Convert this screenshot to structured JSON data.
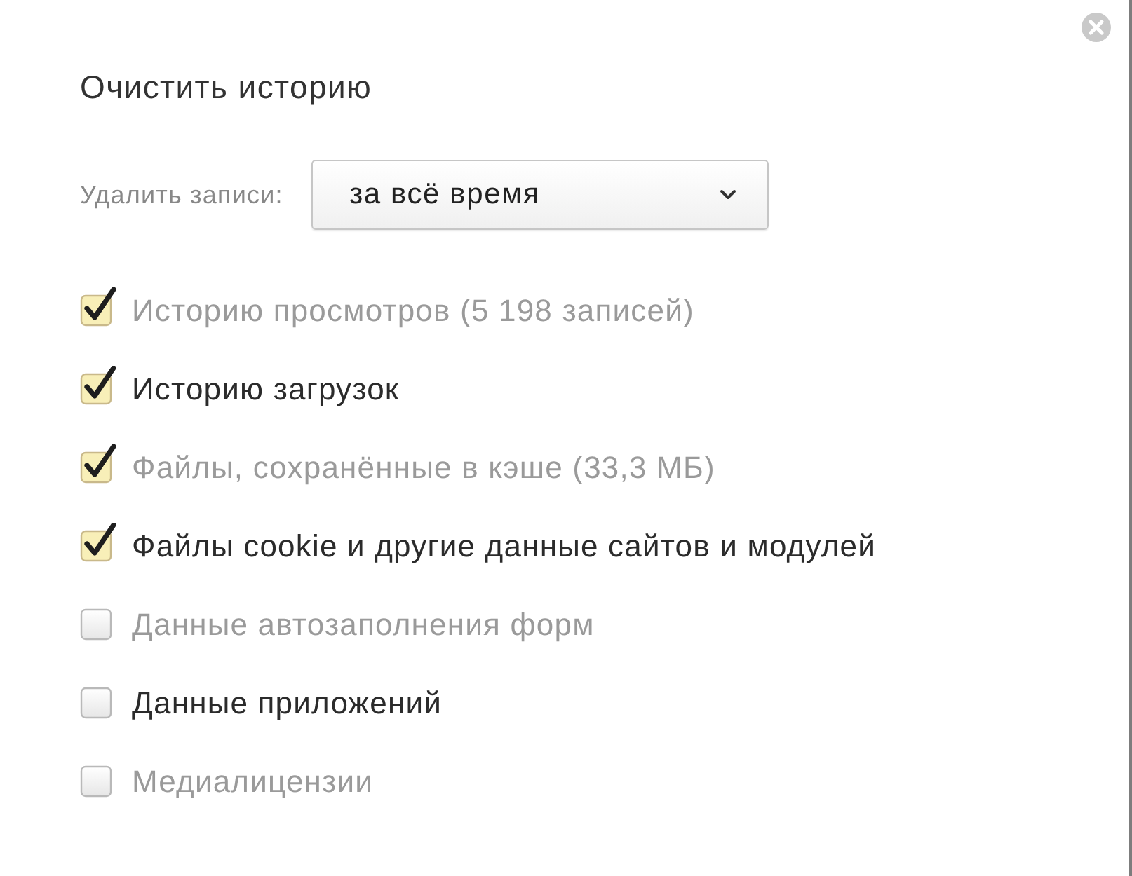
{
  "title": "Очистить историю",
  "range": {
    "label": "Удалить записи:",
    "value": "за всё время"
  },
  "items": [
    {
      "label": "Историю просмотров (5 198 записей)",
      "checked": true,
      "dimmed": true
    },
    {
      "label": "Историю загрузок",
      "checked": true,
      "dimmed": false
    },
    {
      "label": "Файлы, сохранённые в кэше (33,3 МБ)",
      "checked": true,
      "dimmed": true
    },
    {
      "label": "Файлы cookie и другие данные сайтов и модулей",
      "checked": true,
      "dimmed": false
    },
    {
      "label": "Данные автозаполнения форм",
      "checked": false,
      "dimmed": true
    },
    {
      "label": "Данные приложений",
      "checked": false,
      "dimmed": false
    },
    {
      "label": "Медиалицензии",
      "checked": false,
      "dimmed": true
    }
  ]
}
